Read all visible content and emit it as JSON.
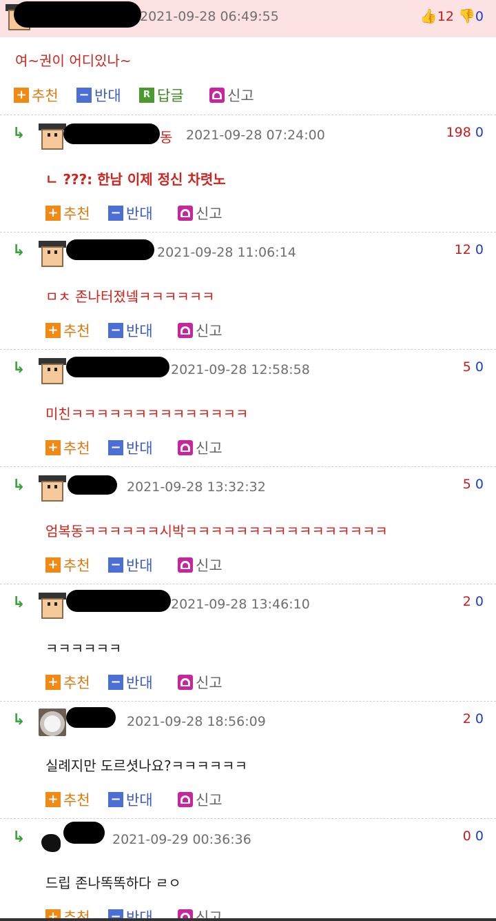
{
  "top": {
    "date": "2021-09-28 06:49:55",
    "up": "12",
    "down": "0",
    "text": "여~권이 어디있나~",
    "actions": {
      "recommend": "추천",
      "oppose": "반대",
      "reply_icon": "R",
      "reply": "답글",
      "report": "신고"
    }
  },
  "replies": [
    {
      "username_partial": "동",
      "date": "2021-09-28 07:24:00",
      "up": "198",
      "down": "0",
      "text": "ㄴ ???: 한남 이제 정신 차렷노",
      "style": "red"
    },
    {
      "username_partial": "",
      "date": "2021-09-28 11:06:14",
      "up": "12",
      "down": "0",
      "text": "ㅁㅊ 존나터졌넼ㅋㅋㅋㅋㅋㅋ",
      "style": "red"
    },
    {
      "username_partial": "",
      "date": "2021-09-28 12:58:58",
      "up": "5",
      "down": "0",
      "text": "미친ㅋㅋㅋㅋㅋㅋㅋㅋㅋㅋㅋㅋㅋㅋ",
      "style": "red"
    },
    {
      "username_partial": "",
      "date": "2021-09-28 13:32:32",
      "up": "5",
      "down": "0",
      "text": "엄복동ㅋㅋㅋㅋㅋㅋ시박ㅋㅋㅋㅋㅋㅋㅋㅋㅋㅋㅋㅋㅋㅋㅋㅋ",
      "style": "red"
    },
    {
      "username_partial": "",
      "date": "2021-09-28 13:46:10",
      "up": "2",
      "down": "0",
      "text": "ㅋㅋㅋㅋㅋㅋ",
      "style": "black"
    },
    {
      "username_partial": "",
      "date": "2021-09-28 18:56:09",
      "up": "2",
      "down": "0",
      "text": "실례지만 도르셧나요?ㅋㅋㅋㅋㅋㅋ",
      "style": "black"
    },
    {
      "username_partial": "",
      "date": "2021-09-29 00:36:36",
      "up": "0",
      "down": "0",
      "text": "드립 존나똑똑하다 ㄹㅇ",
      "style": "black"
    }
  ],
  "reply_actions": {
    "recommend": "추천",
    "oppose": "반대",
    "report": "신고"
  },
  "icons": {
    "reply_arrow": "reply-arrow-icon",
    "thumbs_up": "thumbs-up-icon",
    "thumbs_down": "thumbs-down-icon",
    "plus": "plus-icon",
    "minus": "minus-icon",
    "siren": "siren-icon"
  },
  "colors": {
    "header_bg": "#fde2e4",
    "red_text": "#d0231c",
    "up": "#c71c1c",
    "down": "#1c3ec7"
  }
}
